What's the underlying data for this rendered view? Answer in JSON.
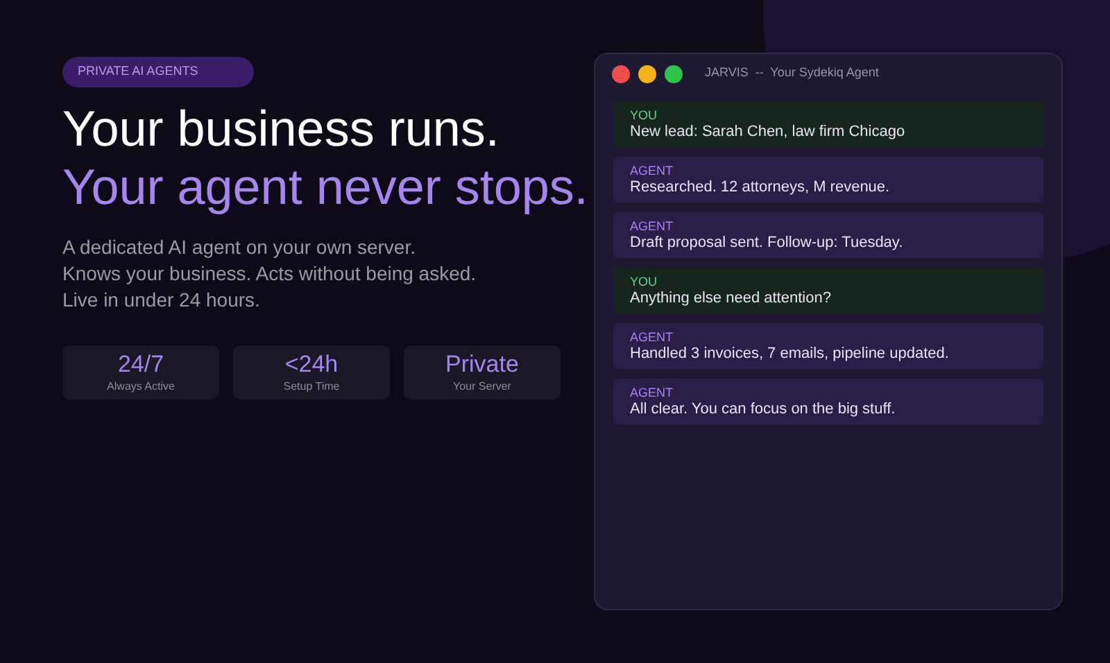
{
  "badge": "PRIVATE AI AGENTS",
  "headline": {
    "line_1": "Your business runs.",
    "line_2": "Your agent never stops."
  },
  "description": [
    "A dedicated AI agent on your own server.",
    "Knows your business. Acts without being asked.",
    "Live in under 24 hours."
  ],
  "stats": [
    {
      "value": "24/7",
      "label": "Always Active"
    },
    {
      "value": "<24h",
      "label": "Setup Time"
    },
    {
      "value": "Private",
      "label": "Your Server"
    }
  ],
  "chat_window": {
    "title": "JARVIS  --  Your Sydekiq Agent",
    "messages": [
      {
        "kind": "user",
        "sender": "YOU",
        "text": "New lead: Sarah Chen, law firm Chicago"
      },
      {
        "kind": "agent",
        "sender": "AGENT",
        "text": "Researched. 12 attorneys, M revenue."
      },
      {
        "kind": "agent",
        "sender": "AGENT",
        "text": "Draft proposal sent. Follow-up: Tuesday."
      },
      {
        "kind": "user",
        "sender": "YOU",
        "text": "Anything else need attention?"
      },
      {
        "kind": "agent",
        "sender": "AGENT",
        "text": "Handled 3 invoices, 7 emails, pipeline updated."
      },
      {
        "kind": "agent",
        "sender": "AGENT",
        "text": "All clear. You can focus on the big stuff."
      }
    ]
  }
}
